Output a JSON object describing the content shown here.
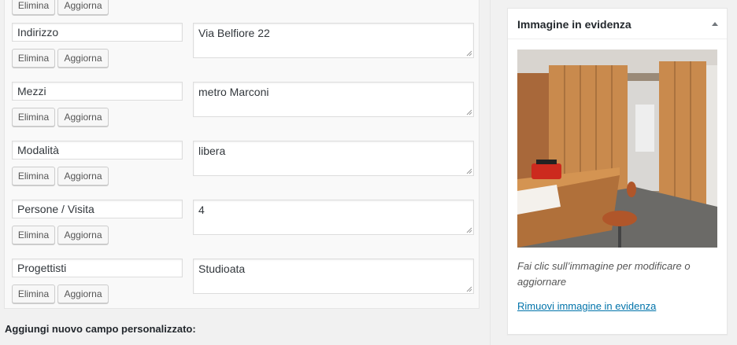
{
  "custom_fields": {
    "rows": [
      {
        "key": "",
        "value": "",
        "delete_label": "Elimina",
        "update_label": "Aggiorna"
      },
      {
        "key": "Indirizzo",
        "value": "Via Belfiore 22",
        "delete_label": "Elimina",
        "update_label": "Aggiorna"
      },
      {
        "key": "Mezzi",
        "value": "metro Marconi",
        "delete_label": "Elimina",
        "update_label": "Aggiorna"
      },
      {
        "key": "Modalità",
        "value": "libera",
        "delete_label": "Elimina",
        "update_label": "Aggiorna"
      },
      {
        "key": "Persone / Visita",
        "value": "4",
        "delete_label": "Elimina",
        "update_label": "Aggiorna"
      },
      {
        "key": "Progettisti",
        "value": "Studioata",
        "delete_label": "Elimina",
        "update_label": "Aggiorna"
      }
    ],
    "add_new_label": "Aggiungi nuovo campo personalizzato:"
  },
  "featured_image": {
    "title": "Immagine in evidenza",
    "toggle_icon": "triangle-up-icon",
    "hint": "Fai clic sull’immagine per modificare o aggiornare",
    "remove_link": "Rimuovi immagine in evidenza"
  },
  "colors": {
    "link": "#0073aa",
    "panel_bg": "#f9f9f9",
    "page_bg": "#f1f1f1"
  }
}
